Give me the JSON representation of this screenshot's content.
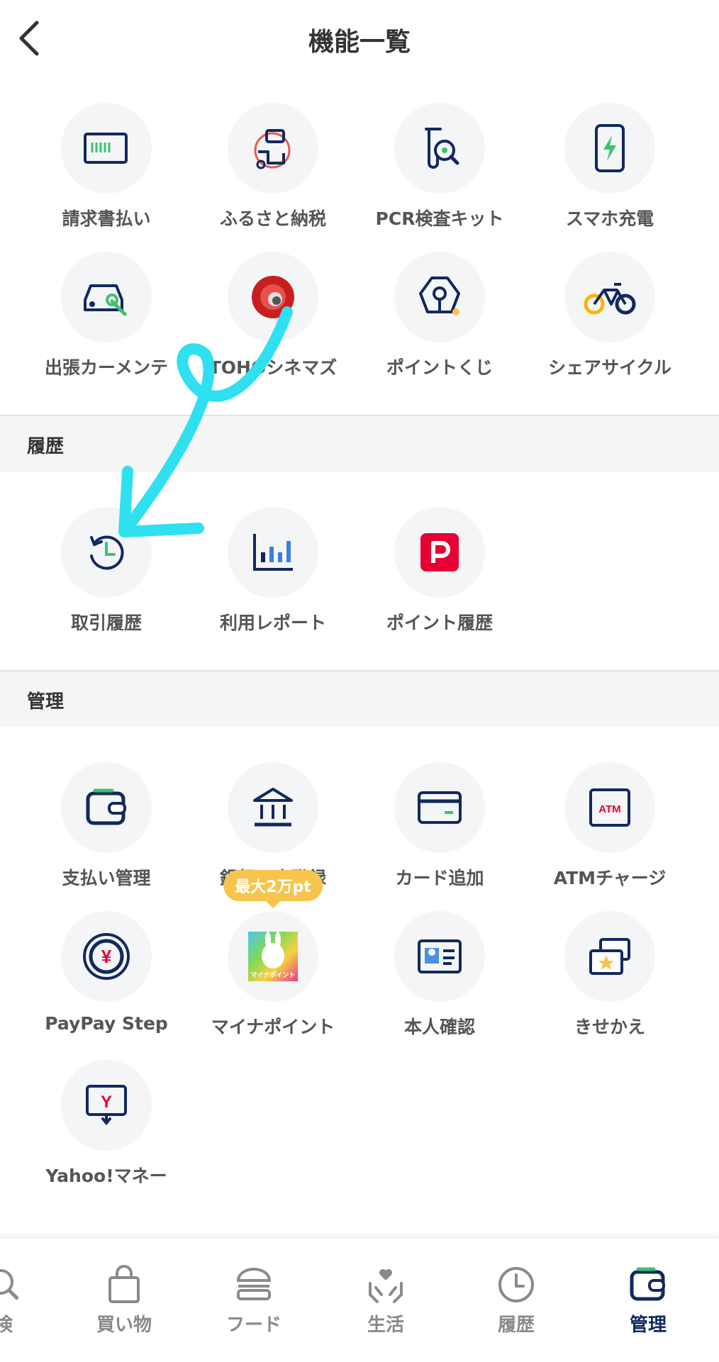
{
  "header": {
    "title": "機能一覧"
  },
  "features": [
    {
      "label": "請求書払い",
      "icon": "invoice-icon"
    },
    {
      "label": "ふるさと納税",
      "icon": "hometown-tax-icon"
    },
    {
      "label": "PCR検査キット",
      "icon": "pcr-test-icon"
    },
    {
      "label": "スマホ充電",
      "icon": "phone-charge-icon"
    },
    {
      "label": "出張カーメンテ",
      "icon": "car-maintenance-icon"
    },
    {
      "label": "TOHOシネマズ",
      "icon": "toho-cinemas-icon"
    },
    {
      "label": "ポイントくじ",
      "icon": "point-lottery-icon"
    },
    {
      "label": "シェアサイクル",
      "icon": "bicycle-icon"
    }
  ],
  "history": {
    "title": "履歴",
    "items": [
      {
        "label": "取引履歴",
        "icon": "clock-history-icon"
      },
      {
        "label": "利用レポート",
        "icon": "bar-chart-icon"
      },
      {
        "label": "ポイント履歴",
        "icon": "paypay-point-icon"
      }
    ]
  },
  "management": {
    "title": "管理",
    "badge": "最大2万pt",
    "items": [
      {
        "label": "支払い管理",
        "icon": "wallet-icon"
      },
      {
        "label": "銀行口座登録",
        "icon": "bank-icon"
      },
      {
        "label": "カード追加",
        "icon": "credit-card-icon"
      },
      {
        "label": "ATMチャージ",
        "icon": "atm-icon",
        "icon_text": "ATM"
      },
      {
        "label": "PayPay Step",
        "icon": "yen-coin-icon",
        "icon_text": "¥"
      },
      {
        "label": "マイナポイント",
        "icon": "mynapoint-icon",
        "icon_text": "マイナポイント"
      },
      {
        "label": "本人確認",
        "icon": "id-card-icon"
      },
      {
        "label": "きせかえ",
        "icon": "theme-cards-icon"
      },
      {
        "label": "Yahoo!マネー",
        "icon": "yahoo-money-icon",
        "icon_text": "Y"
      }
    ]
  },
  "tabs": [
    {
      "label": "検",
      "icon": "search-icon"
    },
    {
      "label": "買い物",
      "icon": "shopping-bag-icon"
    },
    {
      "label": "フード",
      "icon": "burger-icon"
    },
    {
      "label": "生活",
      "icon": "heart-hands-icon"
    },
    {
      "label": "履歴",
      "icon": "clock-icon"
    },
    {
      "label": "管理",
      "icon": "wallet-icon",
      "active": true
    }
  ],
  "colors": {
    "navy": "#12285e",
    "green": "#3dc26e",
    "red": "#e60033",
    "accent_yellow": "#f7c44d",
    "annotation": "#2ee0f0"
  }
}
